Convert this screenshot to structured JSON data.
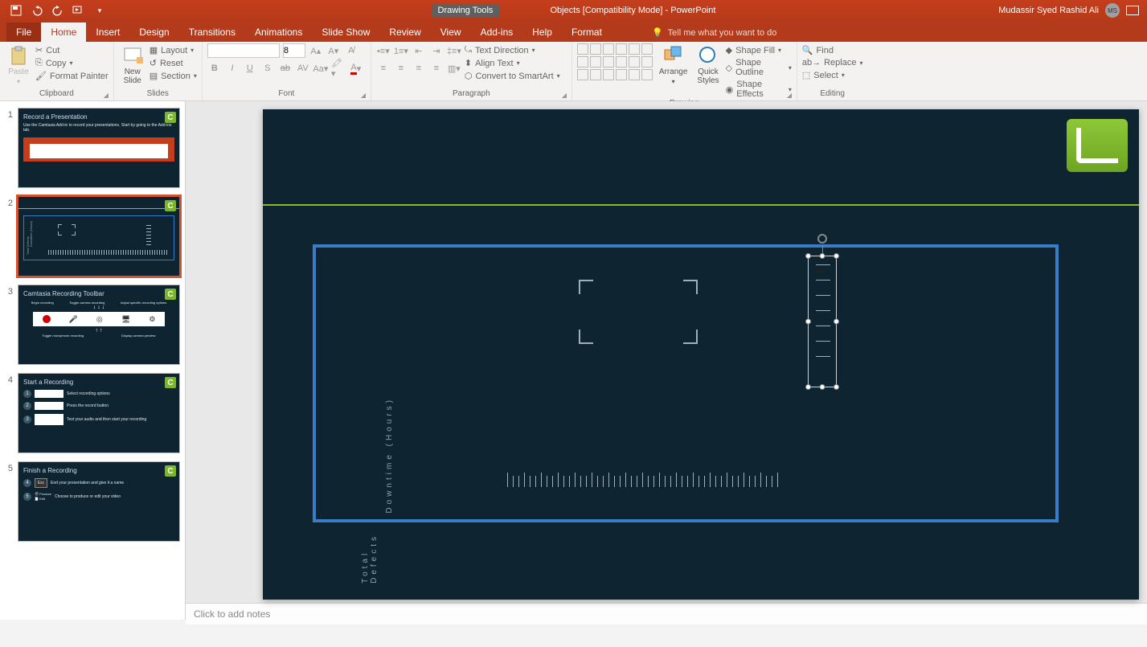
{
  "titlebar": {
    "context_tab": "Drawing Tools",
    "doc_title": "Objects [Compatibility Mode]  -  PowerPoint",
    "user_name": "Mudassir Syed Rashid Ali",
    "user_initials": "MS"
  },
  "tabs": {
    "file": "File",
    "home": "Home",
    "insert": "Insert",
    "design": "Design",
    "transitions": "Transitions",
    "animations": "Animations",
    "slideshow": "Slide Show",
    "review": "Review",
    "view": "View",
    "addins": "Add-ins",
    "help": "Help",
    "format": "Format",
    "tell_me": "Tell me what you want to do"
  },
  "ribbon": {
    "clipboard": {
      "label": "Clipboard",
      "paste": "Paste",
      "cut": "Cut",
      "copy": "Copy",
      "format_painter": "Format Painter"
    },
    "slides": {
      "label": "Slides",
      "new_slide": "New\nSlide",
      "layout": "Layout",
      "reset": "Reset",
      "section": "Section"
    },
    "font": {
      "label": "Font",
      "size": "8"
    },
    "paragraph": {
      "label": "Paragraph",
      "text_direction": "Text Direction",
      "align_text": "Align Text",
      "convert_smartart": "Convert to SmartArt"
    },
    "drawing": {
      "label": "Drawing",
      "arrange": "Arrange",
      "quick_styles": "Quick\nStyles",
      "shape_fill": "Shape Fill",
      "shape_outline": "Shape Outline",
      "shape_effects": "Shape Effects"
    },
    "editing": {
      "label": "Editing",
      "find": "Find",
      "replace": "Replace",
      "select": "Select"
    }
  },
  "thumbs": {
    "t1": {
      "title": "Record a Presentation",
      "desc": "Use the Camtasia Add-in to record your presentations. Start by going to the Add-ins tab."
    },
    "t2": {
      "v1": "Downtime (Hours)",
      "v2": "Total Defects"
    },
    "t3": {
      "title": "Camtasia Recording Toolbar",
      "a": "Begin recording",
      "b": "Toggle camera recording",
      "c": "Adjust specific recording options",
      "d": "Toggle microphone recording",
      "e": "Display camera preview"
    },
    "t4": {
      "title": "Start a Recording",
      "s1": "Select recording options",
      "s2": "Press the record button",
      "s3": "Test your audio and then start your recording"
    },
    "t5": {
      "title": "Finish a Recording",
      "s4": "End your presentation and give it a name",
      "s5": "Choose to produce or edit your video",
      "produce": "Produce",
      "edit": "Edit",
      "esc": "Esc"
    }
  },
  "slide": {
    "axis_y1": "Downtime (Hours)",
    "axis_y2": "Total Defects"
  },
  "notes": {
    "placeholder": "Click to add notes"
  }
}
